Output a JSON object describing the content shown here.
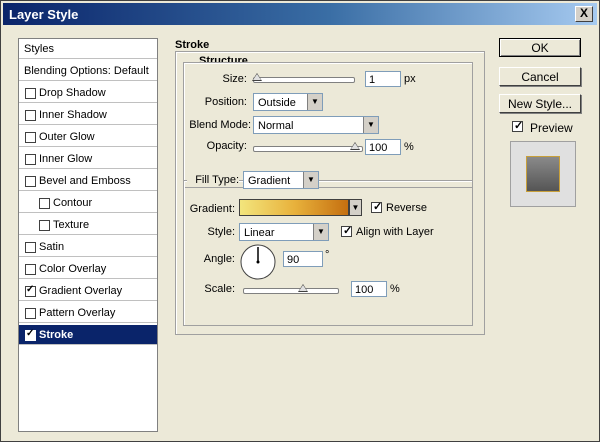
{
  "window": {
    "title": "Layer Style",
    "close_glyph": "X"
  },
  "sidebar": {
    "header": "Styles",
    "blending": "Blending Options: Default",
    "items": [
      {
        "label": "Drop Shadow",
        "checked": false
      },
      {
        "label": "Inner Shadow",
        "checked": false
      },
      {
        "label": "Outer Glow",
        "checked": false
      },
      {
        "label": "Inner Glow",
        "checked": false
      },
      {
        "label": "Bevel and Emboss",
        "checked": false
      },
      {
        "label": "Contour",
        "checked": false
      },
      {
        "label": "Texture",
        "checked": false
      },
      {
        "label": "Satin",
        "checked": false
      },
      {
        "label": "Color Overlay",
        "checked": false
      },
      {
        "label": "Gradient Overlay",
        "checked": true
      },
      {
        "label": "Pattern Overlay",
        "checked": false
      },
      {
        "label": "Stroke",
        "checked": true,
        "selected": true
      }
    ]
  },
  "stroke": {
    "title": "Stroke",
    "structure": {
      "title": "Structure",
      "size_label": "Size:",
      "size_value": "1",
      "size_unit": "px",
      "position_label": "Position:",
      "position_value": "Outside",
      "blend_label": "Blend Mode:",
      "blend_value": "Normal",
      "opacity_label": "Opacity:",
      "opacity_value": "100",
      "opacity_unit": "%"
    },
    "fill": {
      "type_label": "Fill Type:",
      "type_value": "Gradient",
      "gradient_label": "Gradient:",
      "reverse_label": "Reverse",
      "reverse_checked": true,
      "style_label": "Style:",
      "style_value": "Linear",
      "align_label": "Align with Layer",
      "align_checked": true,
      "angle_label": "Angle:",
      "angle_value": "90",
      "angle_unit": "°",
      "scale_label": "Scale:",
      "scale_value": "100",
      "scale_unit": "%"
    }
  },
  "buttons": {
    "ok": "OK",
    "cancel": "Cancel",
    "new_style": "New Style..."
  },
  "preview": {
    "label": "Preview",
    "checked": true
  },
  "colors": {
    "title_start": "#0a246a",
    "selection": "#0a246a",
    "gradient": [
      "#f3e57d",
      "#e8b23c",
      "#c56f10"
    ]
  }
}
